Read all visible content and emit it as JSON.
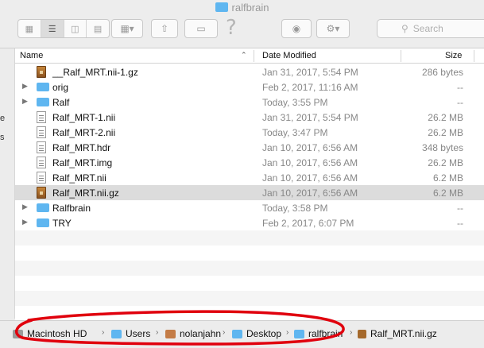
{
  "window": {
    "title": "ralfbrain"
  },
  "search": {
    "placeholder": "Search"
  },
  "sidebar": {
    "fragments": [
      "e",
      "s"
    ]
  },
  "columns": {
    "name": "Name",
    "date": "Date Modified",
    "size": "Size"
  },
  "rows": [
    {
      "name": "__Ralf_MRT.nii-1.gz",
      "date": "Jan 31, 2017, 5:54 PM",
      "size": "286 bytes",
      "kind": "gz-icon",
      "folder": false
    },
    {
      "name": "orig",
      "date": "Feb 2, 2017, 11:16 AM",
      "size": "--",
      "kind": "folder-icon",
      "folder": true
    },
    {
      "name": "Ralf",
      "date": "Today, 3:55 PM",
      "size": "--",
      "kind": "folder-icon",
      "folder": true
    },
    {
      "name": "Ralf_MRT-1.nii",
      "date": "Jan 31, 2017, 5:54 PM",
      "size": "26.2 MB",
      "kind": "document-icon",
      "folder": false
    },
    {
      "name": "Ralf_MRT-2.nii",
      "date": "Today, 3:47 PM",
      "size": "26.2 MB",
      "kind": "document-icon",
      "folder": false
    },
    {
      "name": "Ralf_MRT.hdr",
      "date": "Jan 10, 2017, 6:56 AM",
      "size": "348 bytes",
      "kind": "document-icon",
      "folder": false
    },
    {
      "name": "Ralf_MRT.img",
      "date": "Jan 10, 2017, 6:56 AM",
      "size": "26.2 MB",
      "kind": "document-icon",
      "folder": false
    },
    {
      "name": "Ralf_MRT.nii",
      "date": "Jan 10, 2017, 6:56 AM",
      "size": "6.2 MB",
      "kind": "document-icon",
      "folder": false
    },
    {
      "name": "Ralf_MRT.nii.gz",
      "date": "Jan 10, 2017, 6:56 AM",
      "size": "6.2 MB",
      "kind": "gz-icon",
      "folder": false,
      "selected": true
    },
    {
      "name": "Ralfbrain",
      "date": "Today, 3:58 PM",
      "size": "--",
      "kind": "folder-icon",
      "folder": true
    },
    {
      "name": "TRY",
      "date": "Feb 2, 2017, 6:07 PM",
      "size": "--",
      "kind": "folder-icon",
      "folder": true
    }
  ],
  "pathbar": {
    "items": [
      {
        "label": "Macintosh HD",
        "icon": "hard-drive-icon"
      },
      {
        "label": "Users",
        "icon": "folder-icon"
      },
      {
        "label": "nolanjahn",
        "icon": "home-icon"
      },
      {
        "label": "Desktop",
        "icon": "folder-icon"
      },
      {
        "label": "ralfbrain",
        "icon": "folder-icon"
      },
      {
        "label": "Ralf_MRT.nii.gz",
        "icon": "gz-icon"
      }
    ]
  },
  "colors": {
    "folder": "#5fb6f0",
    "selection": "#dcdcdc",
    "annotation": "#e0000d"
  }
}
